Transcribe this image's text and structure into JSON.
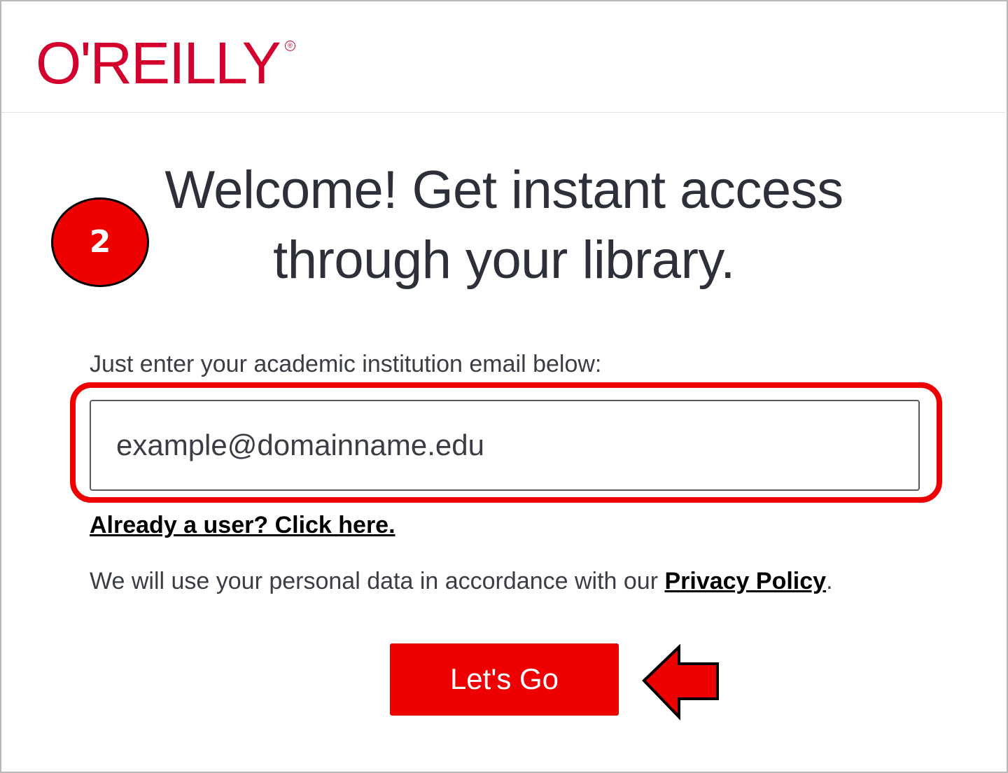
{
  "brand": {
    "logo_text": "O'REILLY",
    "registered_mark": "®",
    "color": "#d3002d"
  },
  "main": {
    "headline_line1": "Welcome! Get instant access",
    "headline_line2": "through your library.",
    "instruction": "Just enter your academic institution email below:",
    "email_placeholder": "example@domainname.edu",
    "already_user_link": "Already a user? Click here.",
    "privacy_text": "We will use your personal data in accordance with our ",
    "privacy_link": "Privacy Policy",
    "privacy_suffix": ".",
    "submit_label": "Let's Go"
  },
  "annotations": {
    "step_number": "2",
    "highlight_color": "#ee0000",
    "arrow_icon": "left-arrow-icon"
  }
}
